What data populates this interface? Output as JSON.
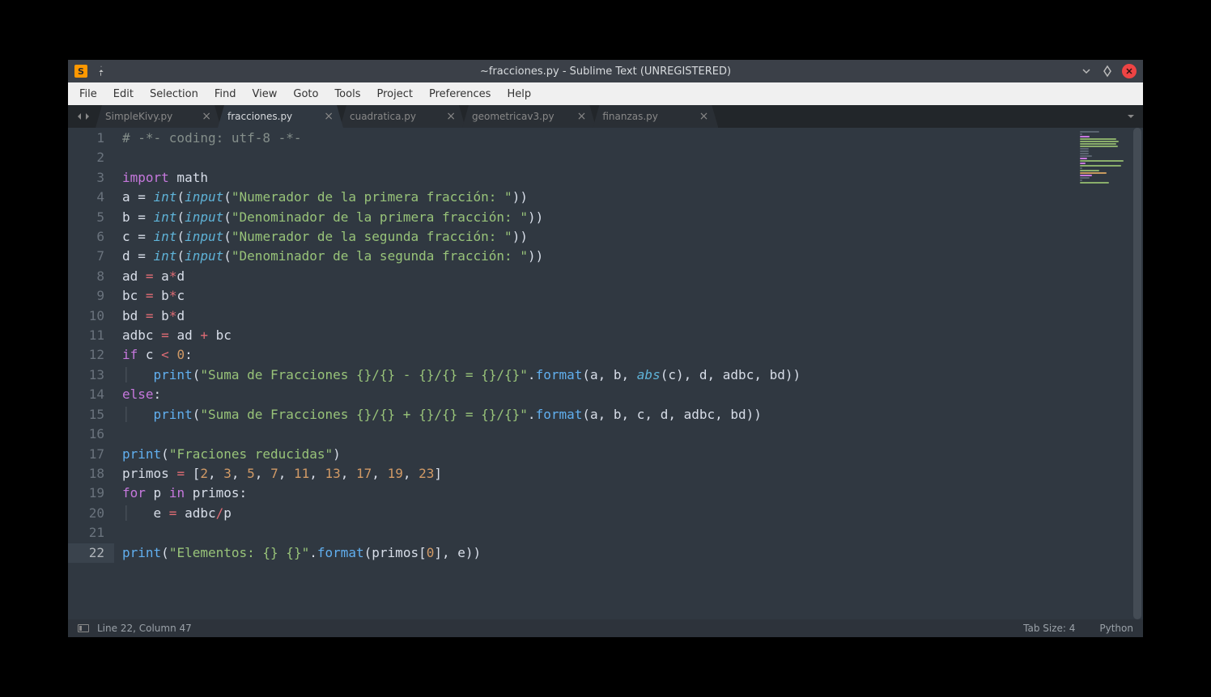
{
  "window": {
    "title": "~fracciones.py - Sublime Text (UNREGISTERED)"
  },
  "menu": [
    "File",
    "Edit",
    "Selection",
    "Find",
    "View",
    "Goto",
    "Tools",
    "Project",
    "Preferences",
    "Help"
  ],
  "tabs": [
    {
      "label": "SimpleKivy.py",
      "active": false
    },
    {
      "label": "fracciones.py",
      "active": true
    },
    {
      "label": "cuadratica.py",
      "active": false
    },
    {
      "label": "geometricav3.py",
      "active": false
    },
    {
      "label": "finanzas.py",
      "active": false
    }
  ],
  "gutter_lines": 22,
  "active_line": 22,
  "code": {
    "l1_comment": "# -*- coding: utf-8 -*-",
    "l3_import": "import",
    "l3_math": " math",
    "l4": {
      "v": "a",
      "eq": " = ",
      "int": "int",
      "inp": "input",
      "s": "\"Numerador de la primera fracción: \""
    },
    "l5": {
      "v": "b",
      "eq": " = ",
      "int": "int",
      "inp": "input",
      "s": "\"Denominador de la primera fracción: \""
    },
    "l6": {
      "v": "c",
      "eq": " = ",
      "int": "int",
      "inp": "input",
      "s": "\"Numerador de la segunda fracción: \""
    },
    "l7": {
      "v": "d",
      "eq": " = ",
      "int": "int",
      "inp": "input",
      "s": "\"Denominador de la segunda fracción: \""
    },
    "l8": {
      "lhs": "ad ",
      "eq": "=",
      "a": " a",
      "op": "*",
      "b": "d"
    },
    "l9": {
      "lhs": "bc ",
      "eq": "=",
      "a": " b",
      "op": "*",
      "b": "c"
    },
    "l10": {
      "lhs": "bd ",
      "eq": "=",
      "a": " b",
      "op": "*",
      "b": "d"
    },
    "l11": {
      "lhs": "adbc ",
      "eq": "=",
      "a": " ad ",
      "op": "+",
      "b": " bc"
    },
    "l12": {
      "if": "if",
      "c": " c ",
      "op": "<",
      "z": " 0",
      ":": ":"
    },
    "l13": {
      "print": "print",
      "s": "\"Suma de Fracciones {}/{} - {}/{} = {}/{}\"",
      "format": "format",
      "abs": "abs",
      "args_a": "a, b, ",
      "args_c": "c",
      "args_rest": ", d, adbc, bd"
    },
    "l14": {
      "else": "else",
      ":": ":"
    },
    "l15": {
      "print": "print",
      "s": "\"Suma de Fracciones {}/{} + {}/{} = {}/{}\"",
      "format": "format",
      "args": "a, b, c, d, adbc, bd"
    },
    "l17": {
      "print": "print",
      "s": "\"Fraciones reducidas\""
    },
    "l18": {
      "lhs": "primos ",
      "eq": "=",
      "open": " [",
      "nums": [
        "2",
        "3",
        "5",
        "7",
        "11",
        "13",
        "17",
        "19",
        "23"
      ],
      "close": "]"
    },
    "l19": {
      "for": "for",
      "p": " p ",
      "in": "in",
      "it": " primos",
      ":": ":"
    },
    "l20": {
      "lhs": "e ",
      "eq": "=",
      "a": " adbc",
      "op": "/",
      "b": "p"
    },
    "l22": {
      "print": "print",
      "s": "\"Elementos: {} {}\"",
      "format": "format",
      "args": "primos[",
      "idx": "0",
      "args2": "], e"
    }
  },
  "status": {
    "position": "Line 22, Column 47",
    "tab_size": "Tab Size: 4",
    "syntax": "Python"
  }
}
